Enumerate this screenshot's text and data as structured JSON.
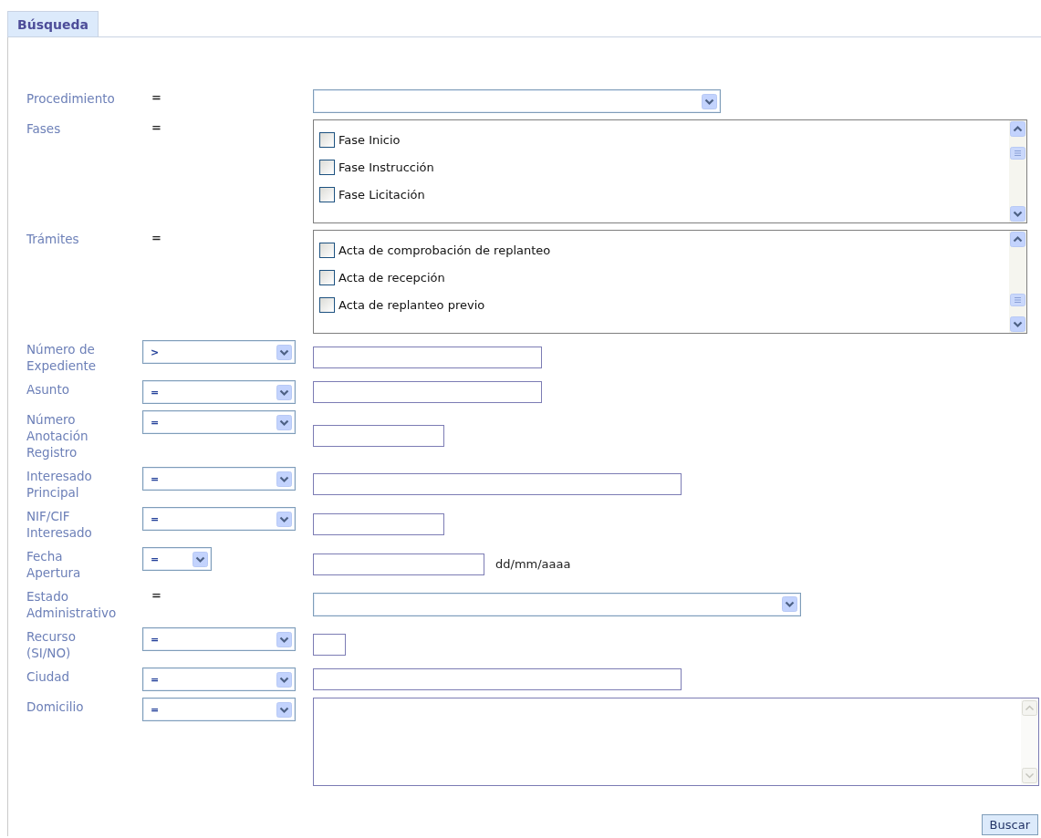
{
  "tabs": [
    {
      "label": "Búsqueda",
      "selected": true
    }
  ],
  "rows": [
    {
      "label": "Procedimiento",
      "operator": {
        "kind": "plain",
        "value": "="
      },
      "field": {
        "kind": "select"
      }
    },
    {
      "label": "Fases",
      "operator": {
        "kind": "plain",
        "value": "="
      },
      "field": {
        "kind": "checklist",
        "items": [
          {
            "label": "Fase Inicio",
            "checked": false
          },
          {
            "label": "Fase Instrucción",
            "checked": false
          },
          {
            "label": "Fase Licitación",
            "checked": false
          }
        ]
      }
    },
    {
      "label": "Trámites",
      "operator": {
        "kind": "plain",
        "value": "="
      },
      "field": {
        "kind": "checklist",
        "items": [
          {
            "label": "Acta de comprobación de replanteo",
            "checked": false
          },
          {
            "label": "Acta de recepción",
            "checked": false
          },
          {
            "label": "Acta de replanteo previo",
            "checked": false
          }
        ]
      }
    },
    {
      "label": "Número de Expediente",
      "operator": {
        "kind": "select",
        "value": ">"
      },
      "field": {
        "kind": "text"
      }
    },
    {
      "label": "Asunto",
      "operator": {
        "kind": "select",
        "value": "="
      },
      "field": {
        "kind": "text"
      }
    },
    {
      "label": "Número Anotación Registro",
      "operator": {
        "kind": "select",
        "value": "="
      },
      "field": {
        "kind": "text"
      }
    },
    {
      "label": "Interesado Principal",
      "operator": {
        "kind": "select",
        "value": "="
      },
      "field": {
        "kind": "text"
      }
    },
    {
      "label": "NIF/CIF Interesado",
      "operator": {
        "kind": "select",
        "value": "="
      },
      "field": {
        "kind": "text"
      }
    },
    {
      "label": "Fecha Apertura",
      "operator": {
        "kind": "select",
        "value": "="
      },
      "field": {
        "kind": "text",
        "suffix": "dd/mm/aaaa"
      }
    },
    {
      "label": "Estado Administrativo",
      "operator": {
        "kind": "plain",
        "value": "="
      },
      "field": {
        "kind": "select"
      }
    },
    {
      "label": "Recurso (SI/NO)",
      "operator": {
        "kind": "select",
        "value": "="
      },
      "field": {
        "kind": "text"
      }
    },
    {
      "label": "Ciudad",
      "operator": {
        "kind": "select",
        "value": "="
      },
      "field": {
        "kind": "text"
      }
    },
    {
      "label": "Domicilio",
      "operator": {
        "kind": "select",
        "value": "="
      },
      "field": {
        "kind": "textarea"
      }
    }
  ],
  "submit_button": "Buscar"
}
